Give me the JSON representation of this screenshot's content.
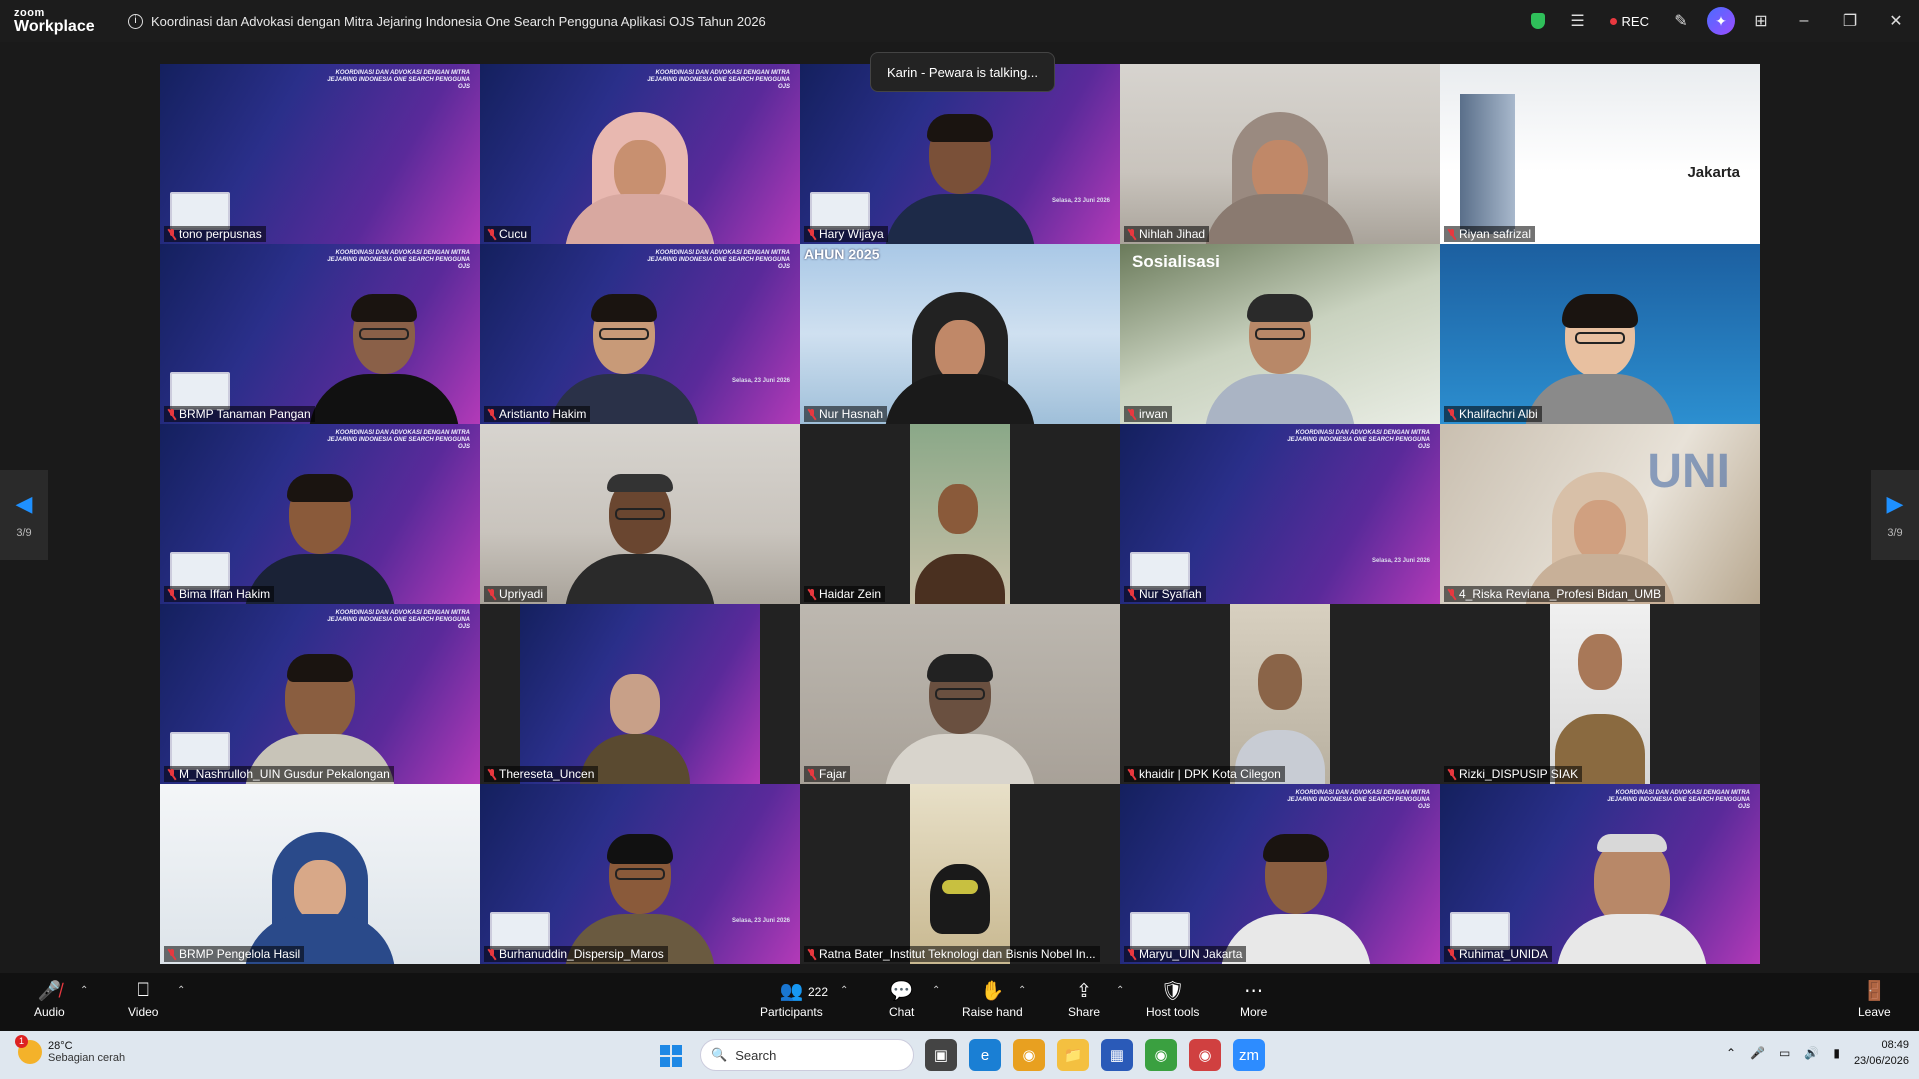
{
  "app": {
    "logo_line1": "zoom",
    "logo_line2": "Workplace",
    "meeting_title": "Koordinasi dan Advokasi dengan Mitra Jejaring Indonesia One Search Pengguna Aplikasi OJS Tahun 2026",
    "rec_label": "REC"
  },
  "stage": {
    "talking_banner": "Karin - Pewara is talking...",
    "page_left": "3/9",
    "page_right": "3/9",
    "slide_heading": "KOORDINASI DAN ADVOKASI DENGAN MITRA JEJARING INDONESIA ONE SEARCH PENGGUNA OJS",
    "slide_date": "Selasa, 23 Juni 2026"
  },
  "participants_tiles": [
    {
      "name": "tono perpusnas"
    },
    {
      "name": "Cucu"
    },
    {
      "name": "Hary Wijaya"
    },
    {
      "name": "Nihlah Jihad"
    },
    {
      "name": "Riyan safrizal"
    },
    {
      "name": "BRMP Tanaman Pangan"
    },
    {
      "name": "Aristianto Hakim"
    },
    {
      "name": "Nur Hasnah"
    },
    {
      "name": "irwan"
    },
    {
      "name": "Khalifachri Albi"
    },
    {
      "name": "Bima Iffan Hakim"
    },
    {
      "name": "Upriyadi"
    },
    {
      "name": "Haidar Zein"
    },
    {
      "name": "Nur Syafiah"
    },
    {
      "name": "4_Riska Reviana_Profesi Bidan_UMB"
    },
    {
      "name": "M_Nashrulloh_UIN Gusdur Pekalongan"
    },
    {
      "name": "Thereseta_Uncen"
    },
    {
      "name": "Fajar"
    },
    {
      "name": "khaidir | DPK Kota Cilegon"
    },
    {
      "name": "Rizki_DISPUSIP SIAK"
    },
    {
      "name": "BRMP Pengelola Hasil"
    },
    {
      "name": "Burhanuddin_Dispersip_Maros"
    },
    {
      "name": "Ratna Bater_Institut Teknologi dan Bisnis Nobel In..."
    },
    {
      "name": "Maryu_UIN Jakarta"
    },
    {
      "name": "Ruhimat_UNIDA"
    }
  ],
  "tile_texts": {
    "sosialisasi": "Sosialisasi",
    "jakarta": "Jakarta",
    "tahun": "AHUN 2025",
    "uni": "UNI"
  },
  "toolbar": {
    "audio": "Audio",
    "video": "Video",
    "participants": "Participants",
    "participants_count": "222",
    "chat": "Chat",
    "raise_hand": "Raise hand",
    "share": "Share",
    "host_tools": "Host tools",
    "more": "More",
    "leave": "Leave"
  },
  "taskbar": {
    "weather_temp": "28°C",
    "weather_desc": "Sebagian cerah",
    "weather_badge": "1",
    "search_placeholder": "Search",
    "time": "08:49",
    "date": "23/06/2026"
  },
  "colors": {
    "accent": "#1e90ff",
    "muted": "#e8383f",
    "secure": "#2fbf5a"
  }
}
